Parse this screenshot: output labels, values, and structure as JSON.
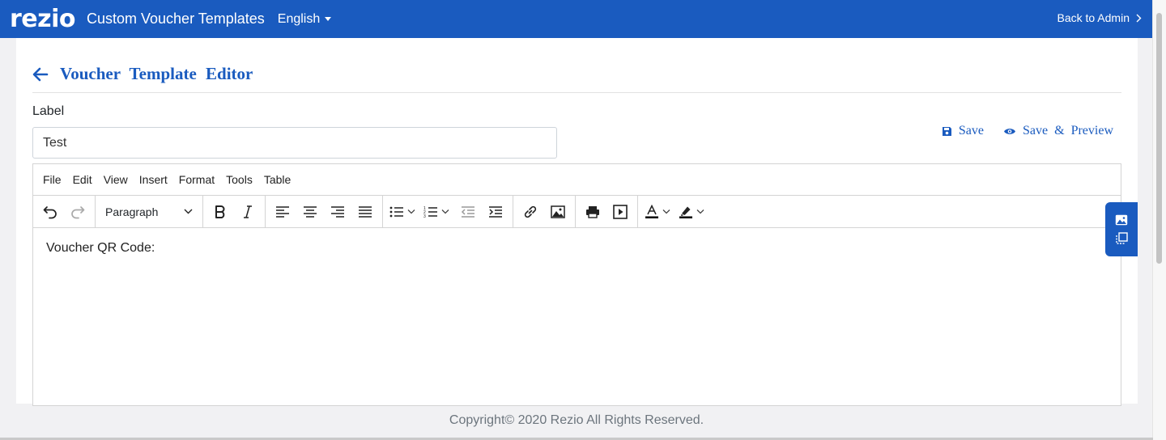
{
  "header": {
    "logo": "rezio",
    "title": "Custom Voucher Templates",
    "language": "English",
    "back_admin": "Back to Admin"
  },
  "page": {
    "title": "Voucher Template Editor",
    "label_caption": "Label",
    "label_value": "Test",
    "save": "Save",
    "save_preview": "Save & Preview"
  },
  "editor": {
    "menu": [
      "File",
      "Edit",
      "View",
      "Insert",
      "Format",
      "Tools",
      "Table"
    ],
    "block_format": "Paragraph",
    "content": "Voucher QR Code:"
  },
  "footer": {
    "copyright": "Copyright© 2020 Rezio All Rights Reserved."
  },
  "colors": {
    "brand": "#1a5bbf",
    "text": "#212529",
    "muted": "#6c757d"
  }
}
